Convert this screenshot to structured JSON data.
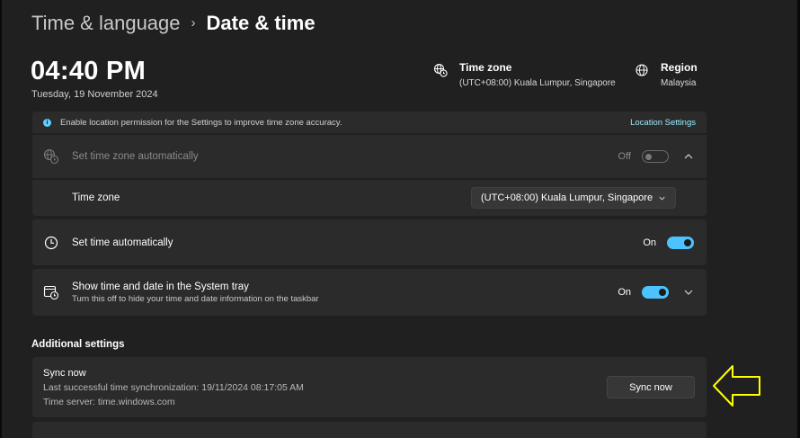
{
  "breadcrumb": {
    "parent": "Time & language",
    "separator": "›",
    "current": "Date & time"
  },
  "clock": {
    "time": "04:40 PM",
    "date": "Tuesday, 19 November 2024"
  },
  "timezone_info": {
    "title": "Time zone",
    "value": "(UTC+08:00) Kuala Lumpur, Singapore",
    "icon": "globe-clock-icon"
  },
  "region_info": {
    "title": "Region",
    "value": "Malaysia",
    "icon": "globe-icon"
  },
  "banner": {
    "icon": "info-icon",
    "text": "Enable location permission for the Settings to improve time zone accuracy.",
    "link": "Location Settings"
  },
  "auto_timezone": {
    "label": "Set time zone automatically",
    "state": "Off",
    "icon": "globe-clock-icon"
  },
  "timezone_row": {
    "label": "Time zone",
    "selected": "(UTC+08:00) Kuala Lumpur, Singapore"
  },
  "auto_time": {
    "label": "Set time automatically",
    "state": "On",
    "icon": "clock-icon"
  },
  "system_tray": {
    "label": "Show time and date in the System tray",
    "sub": "Turn this off to hide your time and date information on the taskbar",
    "state": "On",
    "icon": "calendar-clock-icon"
  },
  "additional": {
    "heading": "Additional settings",
    "sync": {
      "title": "Sync now",
      "last_sync": "Last successful time synchronization: 19/11/2024 08:17:05 AM",
      "server": "Time server: time.windows.com",
      "button": "Sync now"
    }
  },
  "colors": {
    "accent": "#4cc2ff",
    "background": "#202020",
    "card": "#2b2b2b",
    "annotation_arrow": "#ffff00"
  }
}
